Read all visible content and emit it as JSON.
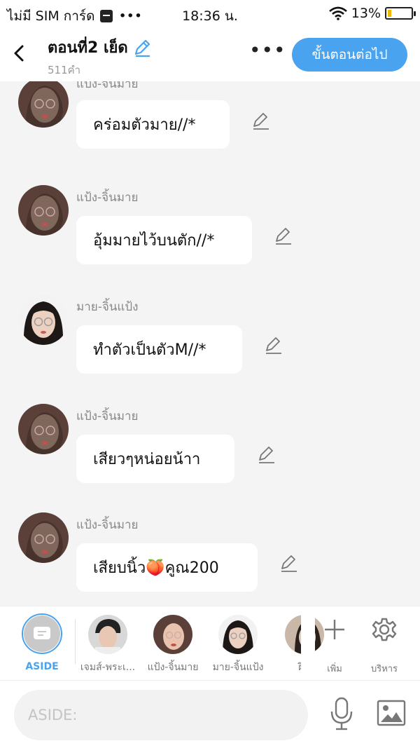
{
  "status_bar": {
    "carrier": "ไม่มี SIM การ์ด",
    "dots": "•••",
    "time": "18:36 น.",
    "battery": "13%"
  },
  "header": {
    "title": "ตอนที่2 เย็ด",
    "word_count": "511คำ",
    "more": "•••",
    "next_button": "ขั้นตอนต่อไป"
  },
  "messages": [
    {
      "sender": "แป้ง-จินมาย",
      "text": "คร่อมตัวมาย//*"
    },
    {
      "sender": "แป้ง-จิ้นมาย",
      "text": "อุ้มมายไว้บนตัก//*"
    },
    {
      "sender": "มาย-จิ้นแป้ง",
      "text": "ทำตัวเป็นตัวM//*"
    },
    {
      "sender": "แป้ง-จิ้นมาย",
      "text": "เสียวๆหน่อยน้าา"
    },
    {
      "sender": "แป้ง-จิ้นมาย",
      "text": "เสียบนิ้ว🍑คูณ200"
    }
  ],
  "character_bar": {
    "aside_label": "ASIDE",
    "characters": [
      {
        "name": "เจมส์-พระเ..."
      },
      {
        "name": "แป้ง-จิ้นมาย"
      },
      {
        "name": "มาย-จิ้นแป้ง"
      },
      {
        "name": "ฝีน"
      }
    ],
    "add_label": "เพิ่ม",
    "manage_label": "บริหาร"
  },
  "input": {
    "placeholder": "ASIDE:"
  },
  "colors": {
    "accent": "#4aa3ef",
    "background": "#f4f4f4",
    "battery_fill": "#f2b705"
  }
}
